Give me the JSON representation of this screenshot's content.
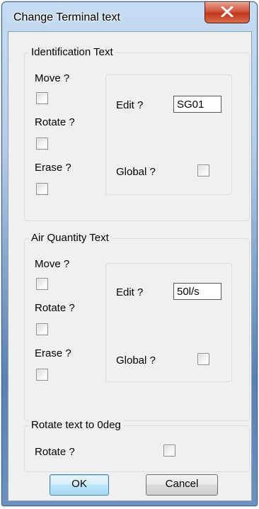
{
  "window": {
    "title": "Change Terminal text",
    "close_label": "x"
  },
  "identification": {
    "title": "Identification Text",
    "move_label": "Move  ?",
    "rotate_label": "Rotate ?",
    "erase_label": "Erase  ?",
    "edit_label": "Edit  ?",
    "edit_value": "SG01",
    "global_label": "Global ?"
  },
  "air_quantity": {
    "title": "Air Quantity Text",
    "move_label": "Move  ?",
    "rotate_label": "Rotate ?",
    "erase_label": "Erase  ?",
    "edit_label": "Edit  ?",
    "edit_value": "50l/s",
    "global_label": "Global ?"
  },
  "rotate_text": {
    "title": "Rotate text to 0deg",
    "rotate_label": "Rotate ?"
  },
  "buttons": {
    "ok_label": "OK",
    "cancel_label": "Cancel"
  }
}
